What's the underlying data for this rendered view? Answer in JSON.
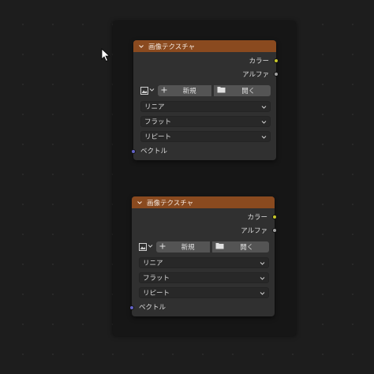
{
  "colors": {
    "background": "#1d1d1d",
    "frame": "#161616",
    "node_body": "#303030",
    "node_header": "#8a4a1f",
    "socket_color": "#c7c729",
    "socket_alpha": "#a1a1a1",
    "socket_vector": "#6363c7"
  },
  "nodes": [
    {
      "title": "画像テクスチャ",
      "outputs": {
        "color": "カラー",
        "alpha": "アルファ"
      },
      "image": {
        "new_label": "新規",
        "open_label": "開く",
        "new_icon": "plus-icon",
        "open_icon": "folder-icon"
      },
      "interpolation": "リニア",
      "projection": "フラット",
      "extension": "リピート",
      "input": "ベクトル"
    },
    {
      "title": "画像テクスチャ",
      "outputs": {
        "color": "カラー",
        "alpha": "アルファ"
      },
      "image": {
        "new_label": "新規",
        "open_label": "開く",
        "new_icon": "plus-icon",
        "open_icon": "folder-icon"
      },
      "interpolation": "リニア",
      "projection": "フラット",
      "extension": "リピート",
      "input": "ベクトル"
    }
  ]
}
